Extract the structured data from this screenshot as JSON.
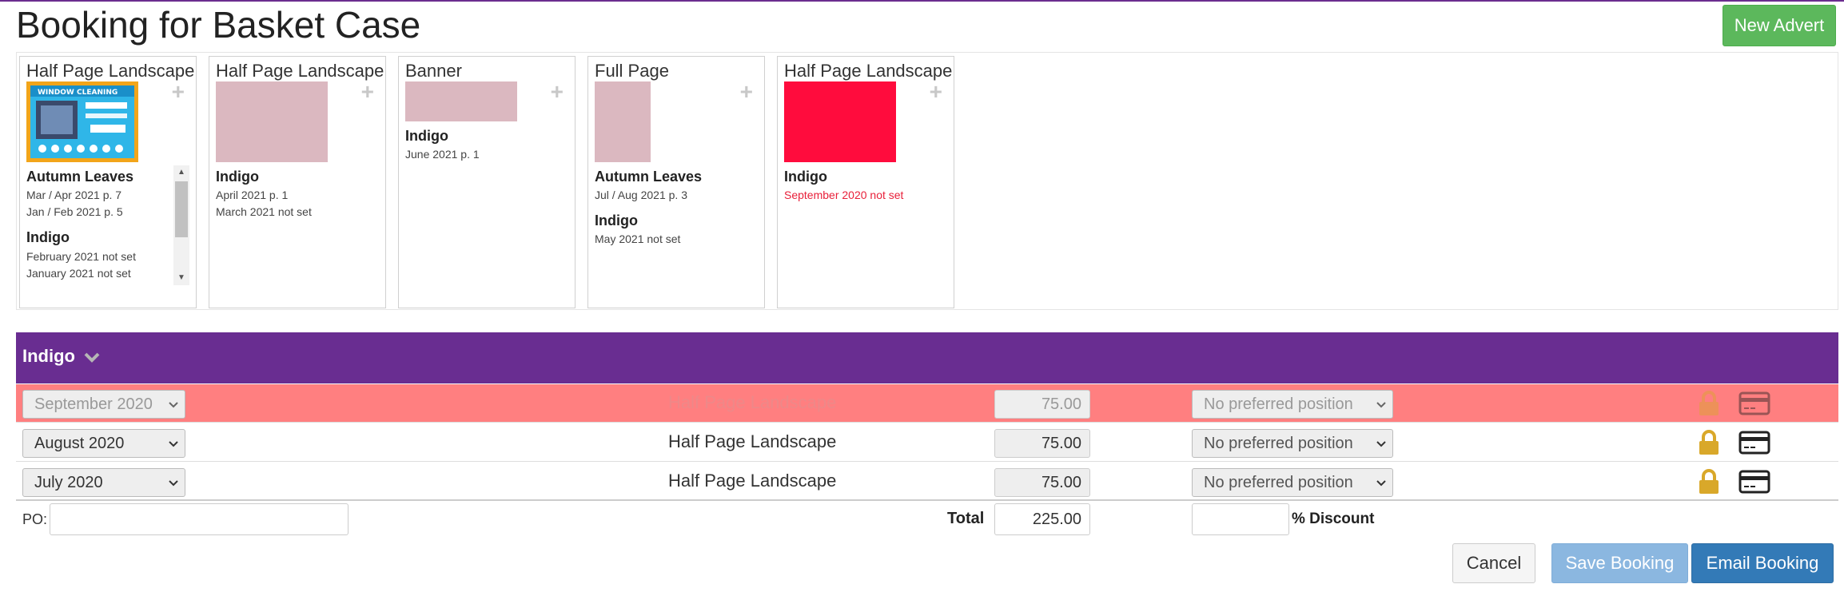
{
  "page": {
    "title": "Booking for Basket Case"
  },
  "toolbar": {
    "new_advert_label": "New Advert"
  },
  "adverts": [
    {
      "size": "Half Page Landscape",
      "publications": [
        {
          "name": "Autumn Leaves",
          "issues": [
            "Mar / Apr 2021 p. 7",
            "Jan / Feb 2021 p. 5"
          ]
        },
        {
          "name": "Indigo",
          "issues": [
            "February 2021 not set",
            "January 2021 not set"
          ]
        }
      ]
    },
    {
      "size": "Half Page Landscape",
      "publications": [
        {
          "name": "Indigo",
          "issues": [
            "April 2021 p. 1",
            "March 2021 not set"
          ]
        }
      ]
    },
    {
      "size": "Banner",
      "publications": [
        {
          "name": "Indigo",
          "issues": [
            "June 2021 p. 1"
          ]
        }
      ]
    },
    {
      "size": "Full Page",
      "publications": [
        {
          "name": "Autumn Leaves",
          "issues": [
            "Jul / Aug 2021 p. 3"
          ]
        },
        {
          "name": "Indigo",
          "issues": [
            "May 2021 not set"
          ]
        }
      ]
    },
    {
      "size": "Half Page Landscape",
      "publications": [
        {
          "name": "Indigo",
          "issues": [
            "September 2020 not set"
          ]
        }
      ]
    }
  ],
  "thumbnail_text": {
    "window_cleaning": "WINDOW CLEANING"
  },
  "group": {
    "name": "Indigo"
  },
  "booking_rows": [
    {
      "issue": "September 2020",
      "size": "Half Page Landscape",
      "price": "75.00",
      "position": "No preferred position",
      "status": "warning"
    },
    {
      "issue": "August 2020",
      "size": "Half Page Landscape",
      "price": "75.00",
      "position": "No preferred position",
      "status": "normal"
    },
    {
      "issue": "July 2020",
      "size": "Half Page Landscape",
      "price": "75.00",
      "position": "No preferred position",
      "status": "normal"
    }
  ],
  "footer": {
    "po_label": "PO:",
    "po_value": "",
    "total_label": "Total",
    "total_value": "225.00",
    "discount_value": "",
    "discount_label": "% Discount"
  },
  "actions": {
    "cancel": "Cancel",
    "save": "Save Booking",
    "email": "Email Booking"
  },
  "colors": {
    "accent_purple": "#692d91",
    "success_green": "#5cb85c",
    "primary_blue": "#337ab7",
    "warning_row": "#ff7f80",
    "placeholder_pink": "#dbb8c0",
    "alert_red": "#ff0c3d",
    "lock_gold": "#d9a82a"
  }
}
